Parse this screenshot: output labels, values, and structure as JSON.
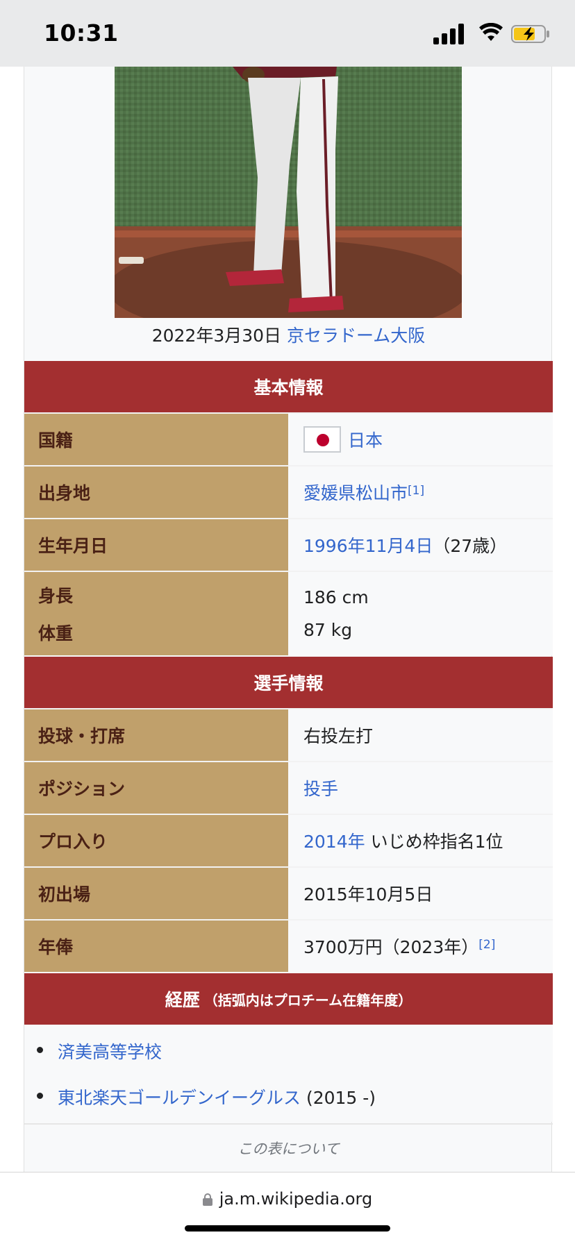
{
  "status": {
    "time": "10:31"
  },
  "photo": {
    "caption_date": "2022年3月30日",
    "caption_link": "京セラドーム大阪"
  },
  "sections": {
    "basic": "基本情報",
    "player": "選手情報",
    "career": "経歴",
    "career_note": "（括弧内はプロチーム在籍年度）"
  },
  "basic_rows": {
    "nationality_label": "国籍",
    "nationality_value": "日本",
    "birthplace_label": "出身地",
    "birthplace_value": "愛媛県松山市",
    "birthplace_ref": "[1]",
    "birthdate_label": "生年月日",
    "birthdate_value": "1996年11月4日",
    "birthdate_age": "（27歳）",
    "height_label": "身長",
    "weight_label": "体重",
    "height_value": "186 cm",
    "weight_value": "87 kg"
  },
  "player_rows": {
    "bats_throws_label": "投球・打席",
    "bats_throws_value": "右投左打",
    "position_label": "ポジション",
    "position_value": "投手",
    "draft_label": "プロ入り",
    "draft_year": "2014年",
    "draft_detail": " いじめ枠指名1位",
    "debut_label": "初出場",
    "debut_value": "2015年10月5日",
    "salary_label": "年俸",
    "salary_value": "3700万円（2023年）",
    "salary_ref": "[2]"
  },
  "career": [
    {
      "name": "済美高等学校",
      "years": ""
    },
    {
      "name": "東北楽天ゴールデンイーグルス",
      "years": " (2015 -)"
    }
  ],
  "about_table": "この表について",
  "browser": {
    "url": "ja.m.wikipedia.org"
  },
  "colors": {
    "section_header": "#a32f30",
    "label_cell": "#c0a06b",
    "link": "#3366cc"
  }
}
